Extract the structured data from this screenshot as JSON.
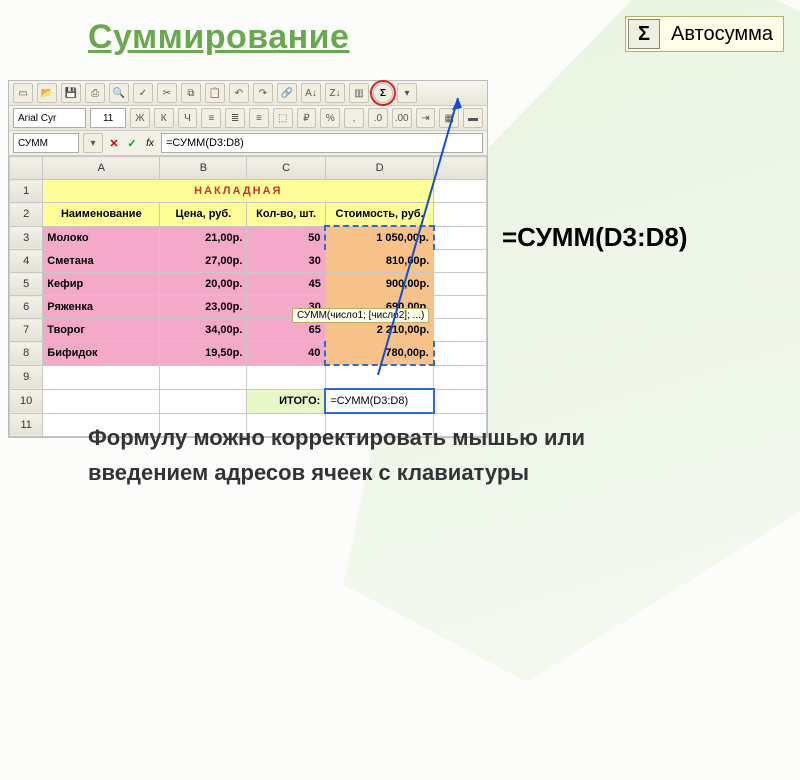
{
  "title": "Суммирование",
  "autosum": {
    "icon": "Σ",
    "label": "Автосумма"
  },
  "toolbar": {
    "font_name": "Arial Cyr",
    "font_size": "11",
    "bold": "Ж",
    "italic": "К",
    "underline": "Ч",
    "sigma": "Σ"
  },
  "formula_bar": {
    "namebox": "СУММ",
    "cancel": "✕",
    "enter": "✓",
    "fx": "fx",
    "formula": "=СУММ(D3:D8)"
  },
  "columns": [
    "",
    "A",
    "B",
    "C",
    "D",
    ""
  ],
  "sheet_title": "НАКЛАДНАЯ",
  "headers": {
    "a": "Наименование",
    "b": "Цена, руб.",
    "c": "Кол-во, шт.",
    "d": "Стоимость, руб."
  },
  "rows": [
    {
      "n": "3",
      "a": "Молоко",
      "b": "21,00р.",
      "c": "50",
      "d": "1 050,00р."
    },
    {
      "n": "4",
      "a": "Сметана",
      "b": "27,00р.",
      "c": "30",
      "d": "810,00р."
    },
    {
      "n": "5",
      "a": "Кефир",
      "b": "20,00р.",
      "c": "45",
      "d": "900,00р."
    },
    {
      "n": "6",
      "a": "Ряженка",
      "b": "23,00р.",
      "c": "30",
      "d": "690,00р."
    },
    {
      "n": "7",
      "a": "Творог",
      "b": "34,00р.",
      "c": "65",
      "d": "2 210,00р."
    },
    {
      "n": "8",
      "a": "Бифидок",
      "b": "19,50р.",
      "c": "40",
      "d": "780,00р."
    }
  ],
  "total_row": {
    "n": "10",
    "label": "ИТОГО:",
    "formula": "=СУММ(D3:D8)"
  },
  "tooltip": "СУММ(число1; [число2]; ...)",
  "big_formula": "=СУММ(D3:D8)",
  "caption": "Формулу можно корректировать мышью или введением адресов ячеек с клавиатуры"
}
